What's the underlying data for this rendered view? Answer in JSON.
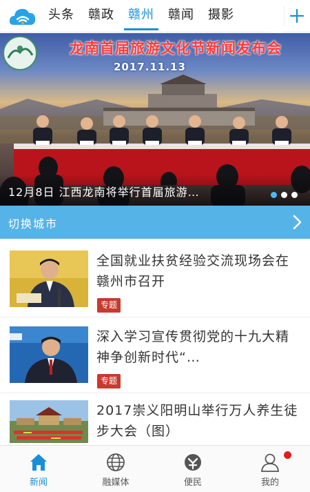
{
  "topbar": {
    "tabs": [
      "头条",
      "赣政",
      "赣州",
      "赣闻",
      "摄影"
    ],
    "active_tab": 2,
    "add_icon": "plus-icon",
    "logo_icon": "cloud-wifi-logo-icon",
    "accent": "#1a8fd8"
  },
  "hero": {
    "banner_title": "龙南首届旅游文化节新闻发布会",
    "banner_date": "2017.11.13",
    "caption": "12月8日 江西龙南将举行首届旅游…",
    "slide_count": 4,
    "active_slide": 0
  },
  "city_switch": {
    "label": "切换城市",
    "color": "#56b3e8"
  },
  "news": [
    {
      "title": "全国就业扶贫经验交流现场会在赣州市召开",
      "tag": "专题"
    },
    {
      "title": "深入学习宣传贯彻党的十九大精神争创新时代“…",
      "tag": "专题"
    },
    {
      "title": "2017崇义阳明山举行万人养生徒步大会（图）",
      "tag": ""
    }
  ],
  "bottom_nav": {
    "items": [
      {
        "label": "新闻",
        "icon": "home-icon"
      },
      {
        "label": "融媒体",
        "icon": "globe-icon"
      },
      {
        "label": "便民",
        "icon": "services-icon"
      },
      {
        "label": "我的",
        "icon": "user-icon"
      }
    ],
    "active": 0,
    "badge_color": "#e0201c"
  }
}
